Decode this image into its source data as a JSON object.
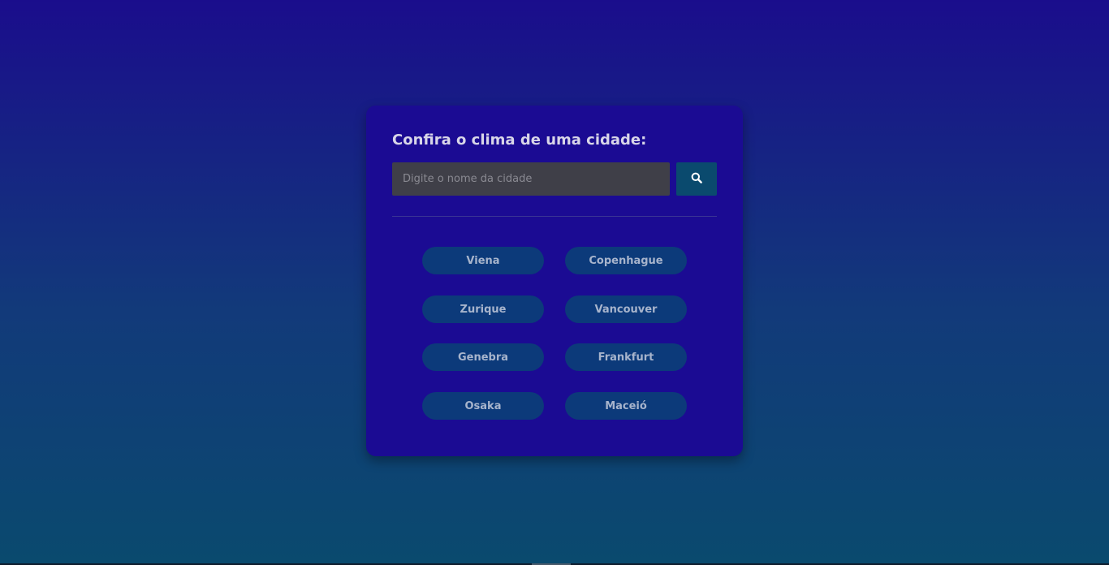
{
  "card": {
    "title": "Confira o clima de uma cidade:"
  },
  "search": {
    "placeholder": "Digite o nome da cidade",
    "value": "",
    "button_icon": "search-icon"
  },
  "cities": [
    "Viena",
    "Copenhague",
    "Zurique",
    "Vancouver",
    "Genebra",
    "Frankfurt",
    "Osaka",
    "Maceió"
  ],
  "colors": {
    "card_background": "#1b0b93",
    "city_button_background": "#0c3a7a",
    "search_button_background": "#0a4a6e",
    "input_background": "#3f3f48"
  }
}
